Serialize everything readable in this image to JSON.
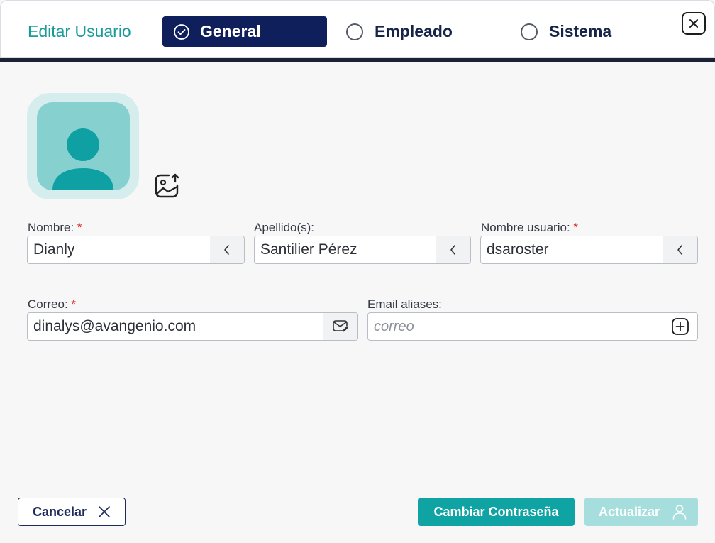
{
  "header": {
    "title": "Editar Usuario",
    "tabs": [
      {
        "label": "General",
        "state": "selected"
      },
      {
        "label": "Empleado",
        "state": "unselected"
      },
      {
        "label": "Sistema",
        "state": "unselected"
      }
    ],
    "close_icon": "close-icon"
  },
  "avatar": {
    "icon": "user-silhouette-icon",
    "upload_icon": "image-upload-icon"
  },
  "form": {
    "nombre": {
      "label": "Nombre:",
      "required_mark": "*",
      "value": "Dianly",
      "addon_icon": "chevron-left-icon"
    },
    "apellidos": {
      "label": "Apellido(s):",
      "value": "Santilier Pérez",
      "addon_icon": "chevron-left-icon"
    },
    "usuario": {
      "label": "Nombre usuario:",
      "required_mark": "*",
      "value": "dsaroster",
      "addon_icon": "chevron-left-icon"
    },
    "correo": {
      "label": "Correo:",
      "required_mark": "*",
      "value": "dinalys@avangenio.com",
      "addon_icon": "mail-edit-icon"
    },
    "aliases": {
      "label": "Email aliases:",
      "placeholder": "correo",
      "addon_icon": "plus-square-icon"
    }
  },
  "footer": {
    "cancel_label": "Cancelar",
    "change_password_label": "Cambiar Contraseña",
    "update_label": "Actualizar"
  },
  "colors": {
    "accent": "#0fa3a3",
    "navy": "#0f1f5c",
    "required": "#e02424",
    "disabled_accent": "#a6dede"
  }
}
